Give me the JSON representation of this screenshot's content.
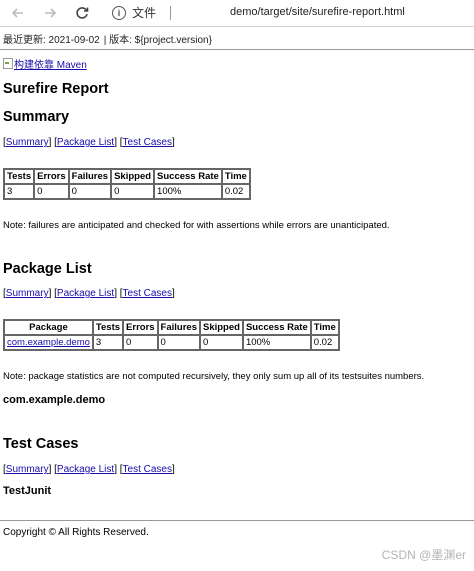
{
  "browser": {
    "info_label": "文件",
    "url": "demo/target/site/surefire-report.html"
  },
  "header": {
    "last_updated": "最近更新: 2021-09-02",
    "version": "| 版本: ${project.version}"
  },
  "logo": {
    "alt": "构建依靠 Maven"
  },
  "page": {
    "title": "Surefire Report"
  },
  "nav": {
    "summary": "Summary",
    "package_list": "Package List",
    "test_cases": "Test Cases"
  },
  "summary": {
    "heading": "Summary",
    "columns": [
      "Tests",
      "Errors",
      "Failures",
      "Skipped",
      "Success Rate",
      "Time"
    ],
    "row": [
      "3",
      "0",
      "0",
      "0",
      "100%",
      "0.02"
    ],
    "note": "Note: failures are anticipated and checked for with assertions while errors are unanticipated."
  },
  "package_list": {
    "heading": "Package List",
    "columns": [
      "Package",
      "Tests",
      "Errors",
      "Failures",
      "Skipped",
      "Success Rate",
      "Time"
    ],
    "row": [
      "com.example.demo",
      "3",
      "0",
      "0",
      "0",
      "100%",
      "0.02"
    ],
    "note": "Note: package statistics are not computed recursively, they only sum up all of its testsuites numbers.",
    "package_heading": "com.example.demo"
  },
  "test_cases": {
    "heading": "Test Cases",
    "class_heading": "TestJunit"
  },
  "footer": {
    "copyright": "Copyright © All Rights Reserved."
  },
  "watermark": "CSDN @墨渊er"
}
